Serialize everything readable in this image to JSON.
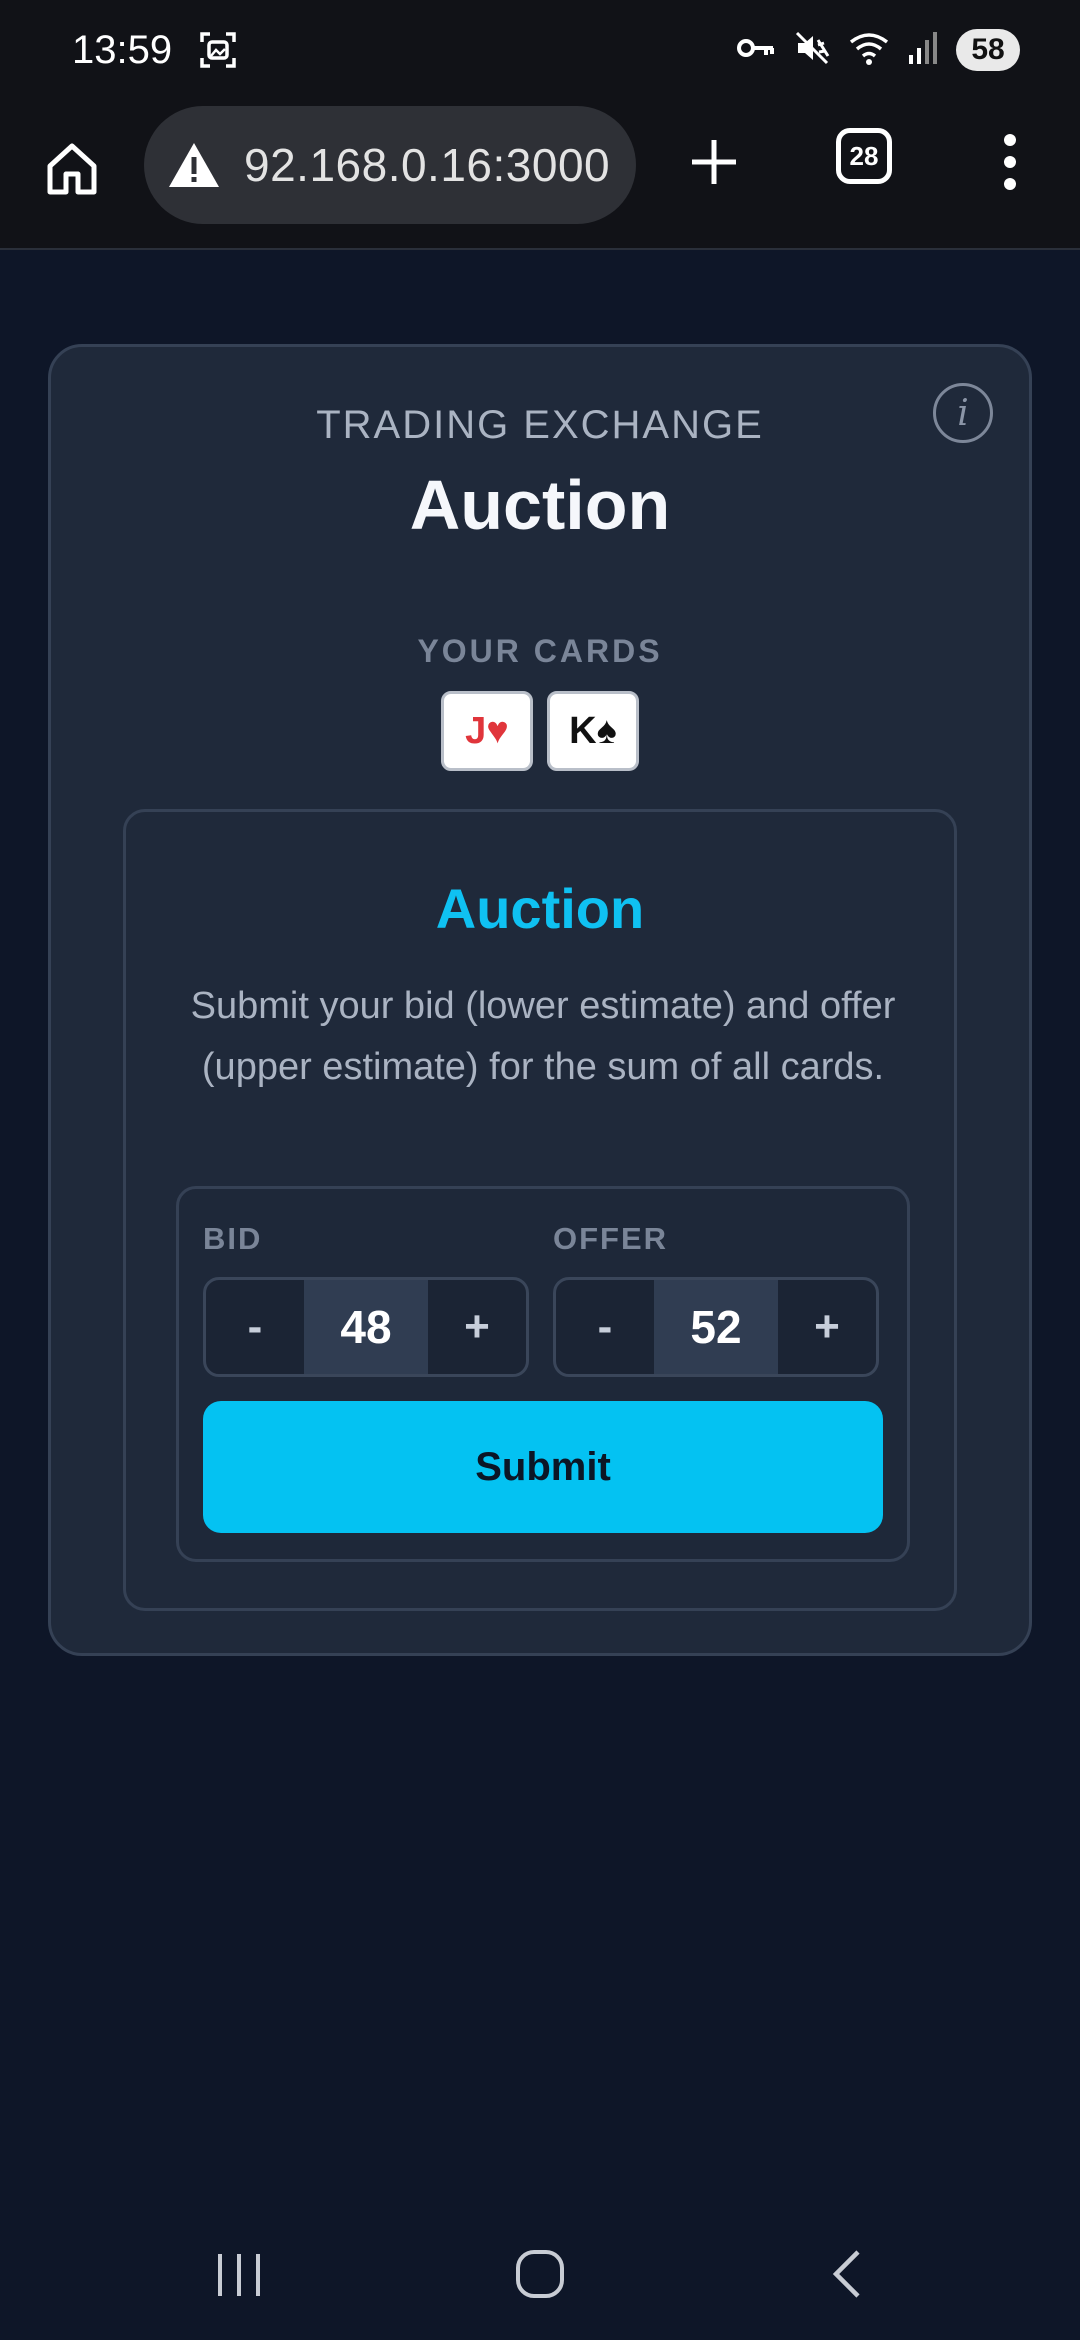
{
  "status_bar": {
    "time": "13:59",
    "battery": "58",
    "icons": [
      "screen-capture-icon",
      "vpn-key-icon",
      "mute-icon",
      "wifi-icon",
      "signal-icon"
    ]
  },
  "browser": {
    "url": "92.168.0.16:3000",
    "tab_count": "28",
    "icons": [
      "home-icon",
      "warning-icon",
      "plus-icon",
      "more-vert-icon"
    ]
  },
  "header": {
    "eyebrow": "TRADING EXCHANGE",
    "title": "Auction",
    "info_glyph": "i"
  },
  "cards": {
    "label": "YOUR CARDS",
    "items": [
      {
        "text": "J♥",
        "color": "#e0353b"
      },
      {
        "text": "K♠",
        "color": "#111111"
      }
    ]
  },
  "auction": {
    "heading": "Auction",
    "description": "Submit your bid (lower estimate) and offer (upper estimate) for the sum of all cards.",
    "bid": {
      "label": "BID",
      "value": "48",
      "minus": "-",
      "plus": "+"
    },
    "offer": {
      "label": "OFFER",
      "value": "52",
      "minus": "-",
      "plus": "+"
    },
    "submit_label": "Submit"
  },
  "colors": {
    "accent": "#04c2f2",
    "background": "#0e1628",
    "card_surface": "#1f293a"
  }
}
